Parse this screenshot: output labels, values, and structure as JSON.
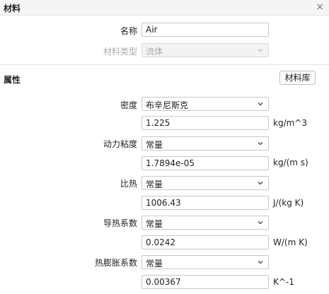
{
  "window": {
    "title": "材料",
    "close_glyph": "×"
  },
  "basic": {
    "name_label": "名称",
    "name_value": "Air",
    "type_label": "材料类型",
    "type_value": "流体"
  },
  "properties": {
    "title": "属性",
    "library_button": "材料库",
    "rows": [
      {
        "label": "密度",
        "method": "布辛尼斯克",
        "value": "1.225",
        "unit": "kg/m^3"
      },
      {
        "label": "动力粘度",
        "method": "常量",
        "value": "1.7894e-05",
        "unit": "kg/(m s)"
      },
      {
        "label": "比热",
        "method": "常量",
        "value": "1006.43",
        "unit": "J/(kg K)"
      },
      {
        "label": "导热系数",
        "method": "常量",
        "value": "0.0242",
        "unit": "W/(m K)"
      },
      {
        "label": "热膨胀系数",
        "method": "常量",
        "value": "0.00367",
        "unit": "K^-1"
      }
    ]
  },
  "icons": {
    "close": "close-icon",
    "dropdown": "chevron-down-icon"
  }
}
